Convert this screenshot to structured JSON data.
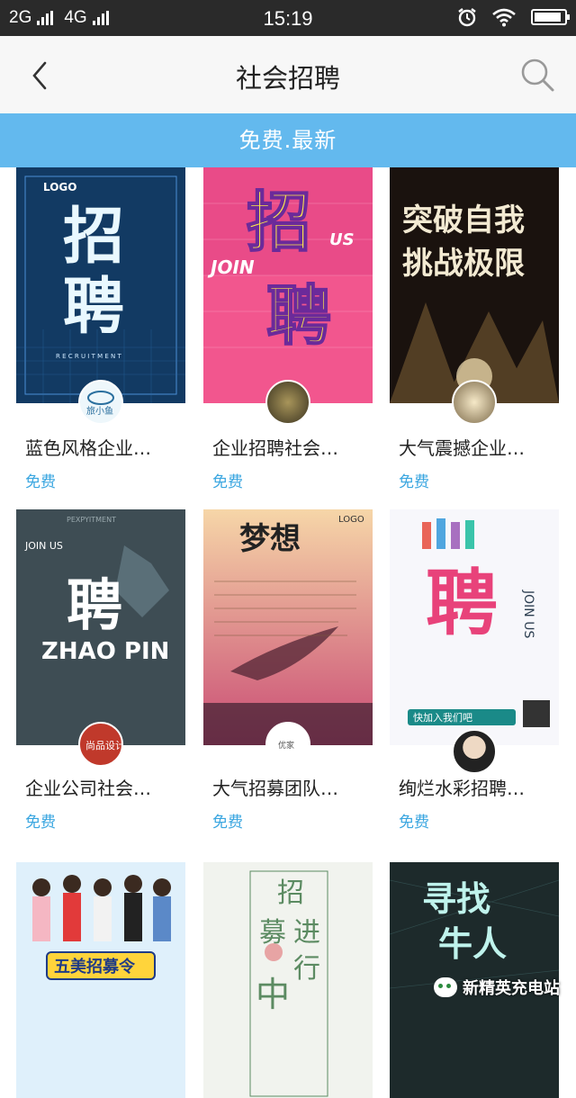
{
  "status_bar": {
    "network_1": "2G",
    "network_2": "4G",
    "time": "15:19",
    "battery_level": 0.9,
    "icons": [
      "signal-icon",
      "alarm-icon",
      "wifi-icon",
      "battery-icon"
    ]
  },
  "nav": {
    "title": "社会招聘",
    "back_icon": "chevron-left-icon",
    "search_icon": "search-icon"
  },
  "banner": {
    "label": "免费.最新"
  },
  "cards": [
    {
      "title": "蓝色风格企业…",
      "price": "免费",
      "poster": {
        "text1": "LOGO",
        "text2": "招",
        "text3": "聘",
        "text4": "R E C R U I T M E N T",
        "bg": "#123a63",
        "accent": "#dff6ff"
      },
      "avatar_text": "旅小鱼"
    },
    {
      "title": "企业招聘社会…",
      "price": "免费",
      "poster": {
        "text1": "JOIN",
        "text2": "招",
        "text3": "聘",
        "text4": "US",
        "bg": "#f2568e",
        "accent": "#ffe94a"
      },
      "avatar_text": ""
    },
    {
      "title": "大气震撼企业…",
      "price": "免费",
      "poster": {
        "text1": "突破自我",
        "text2": "挑战极限",
        "bg": "#1a120e",
        "accent": "#f0e8d0"
      },
      "avatar_text": ""
    },
    {
      "title": "企业公司社会…",
      "price": "免费",
      "poster": {
        "text1": "JOIN US",
        "text2": "聘",
        "text3": "ZHAO PIN",
        "text4": "PEXPYITMENT",
        "bg": "#3e4d54",
        "accent": "#ffffff"
      },
      "avatar_text": "尚品设计"
    },
    {
      "title": "大气招募团队…",
      "price": "免费",
      "poster": {
        "text1": "梦想",
        "text2": "LOGO",
        "bg": "#f6d6a8",
        "accent": "#222222"
      },
      "avatar_text": "优家"
    },
    {
      "title": "绚烂水彩招聘…",
      "price": "免费",
      "poster": {
        "text1": "聘",
        "text2": "JOIN US",
        "text3": "快加入我们吧",
        "bg": "#f7f7fb",
        "accent": "#e8427a"
      },
      "avatar_text": ""
    },
    {
      "title": "",
      "price": "",
      "poster": {
        "text1": "五美招募令",
        "bg": "#dff0fb",
        "accent": "#1f3b86"
      },
      "avatar_text": ""
    },
    {
      "title": "",
      "price": "",
      "poster": {
        "text1": "招",
        "text2": "募",
        "text3": "进",
        "text4": "行",
        "text5": "中",
        "bg": "#f1f3ee",
        "accent": "#5c8b62"
      },
      "avatar_text": ""
    },
    {
      "title": "",
      "price": "",
      "poster": {
        "text1": "寻找",
        "text2": "牛人",
        "bg": "#1d2a2b",
        "accent": "#bff3ec"
      },
      "avatar_text": ""
    }
  ],
  "watermark": {
    "text": "新精英充电站"
  }
}
